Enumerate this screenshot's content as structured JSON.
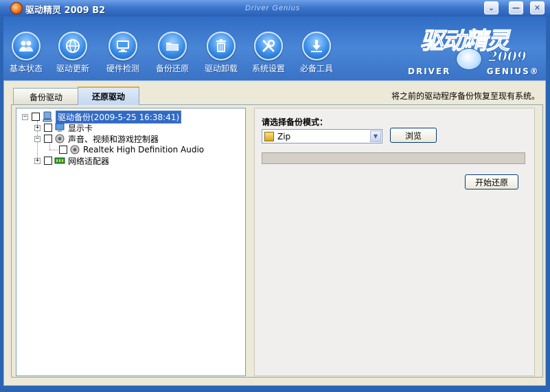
{
  "window": {
    "title": "驱动精灵 2009 B2",
    "brand_title": "Driver Genius",
    "controls": {
      "minimize": "⌄",
      "maximize": "—",
      "close": "✕"
    }
  },
  "toolbar": {
    "items": [
      {
        "label": "基本状态",
        "icon": "users-icon"
      },
      {
        "label": "驱动更新",
        "icon": "globe-icon"
      },
      {
        "label": "硬件检测",
        "icon": "monitor-icon"
      },
      {
        "label": "备份还原",
        "icon": "folder-icon"
      },
      {
        "label": "驱动卸载",
        "icon": "trash-icon"
      },
      {
        "label": "系统设置",
        "icon": "tools-icon"
      },
      {
        "label": "必备工具",
        "icon": "download-icon"
      }
    ]
  },
  "logo": {
    "cn": "驱动精灵",
    "year": "2009",
    "en_left": "DRIVER",
    "en_right": "GENIUS®"
  },
  "tabs": [
    {
      "label": "备份驱动",
      "active": false
    },
    {
      "label": "还原驱动",
      "active": true
    }
  ],
  "hint": "将之前的驱动程序备份恢复至现有系统。",
  "tree": {
    "root": {
      "label": "驱动备份(2009-5-25 16:38:41)",
      "expander": "−",
      "selected": true
    },
    "children": [
      {
        "label": "显示卡",
        "expander": "+",
        "icon": "display-adapter-icon"
      },
      {
        "label": "声音、视频和游戏控制器",
        "expander": "−",
        "icon": "sound-icon",
        "children": [
          {
            "label": "Realtek High Definition Audio",
            "icon": "sound-icon"
          }
        ]
      },
      {
        "label": "网络适配器",
        "expander": "+",
        "icon": "network-adapter-icon"
      }
    ]
  },
  "restore": {
    "mode_label": "请选择备份模式：",
    "mode_value": "Zip",
    "browse_label": "浏览",
    "progress": 0,
    "start_label": "开始还原"
  },
  "colors": {
    "titlebar": "#3d77cc",
    "toolbar": "#4a86d6",
    "panel_bg": "#ece9d8",
    "selection": "#316ac5",
    "active_tab_accent": "#e8a93a"
  }
}
